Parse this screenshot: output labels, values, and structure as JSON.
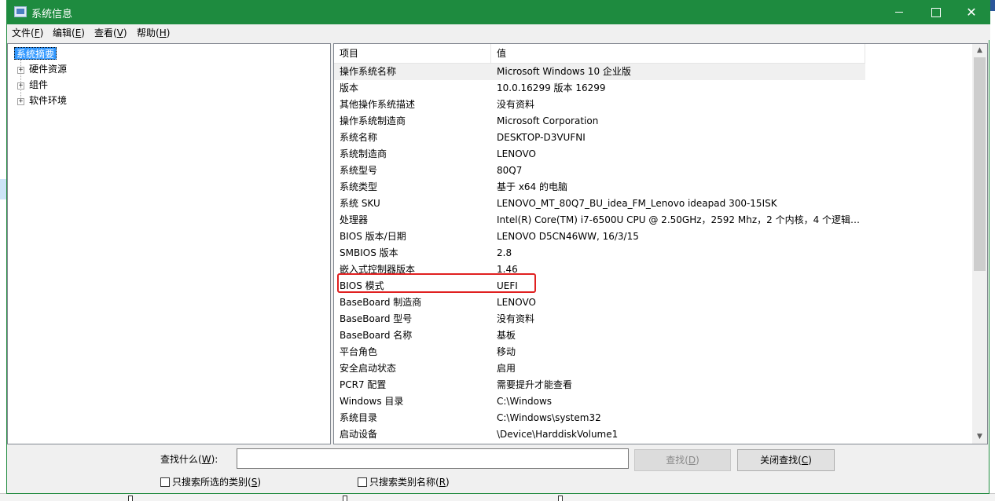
{
  "window": {
    "title": "系统信息",
    "minimize_glyph": "",
    "maximize_glyph": "",
    "close_glyph": "✕"
  },
  "menu": [
    {
      "label": "文件(",
      "key": "F",
      "tail": ")"
    },
    {
      "label": "编辑(",
      "key": "E",
      "tail": ")"
    },
    {
      "label": "查看(",
      "key": "V",
      "tail": ")"
    },
    {
      "label": "帮助(",
      "key": "H",
      "tail": ")"
    }
  ],
  "tree": {
    "root": "系统摘要",
    "expander": "+",
    "nodes": [
      "硬件资源",
      "组件",
      "软件环境"
    ]
  },
  "list": {
    "columns": [
      "项目",
      "值"
    ],
    "rows": [
      {
        "item": "操作系统名称",
        "value": "Microsoft Windows 10 企业版"
      },
      {
        "item": "版本",
        "value": "10.0.16299 版本 16299"
      },
      {
        "item": "其他操作系统描述",
        "value": "没有资料"
      },
      {
        "item": "操作系统制造商",
        "value": "Microsoft Corporation"
      },
      {
        "item": "系统名称",
        "value": "DESKTOP-D3VUFNI"
      },
      {
        "item": "系统制造商",
        "value": "LENOVO"
      },
      {
        "item": "系统型号",
        "value": "80Q7"
      },
      {
        "item": "系统类型",
        "value": "基于 x64 的电脑"
      },
      {
        "item": "系统 SKU",
        "value": "LENOVO_MT_80Q7_BU_idea_FM_Lenovo ideapad 300-15ISK"
      },
      {
        "item": "处理器",
        "value": "Intel(R) Core(TM) i7-6500U CPU @ 2.50GHz，2592 Mhz，2 个内核，4 个逻辑处..."
      },
      {
        "item": "BIOS 版本/日期",
        "value": "LENOVO D5CN46WW, 16/3/15"
      },
      {
        "item": "SMBIOS 版本",
        "value": "2.8"
      },
      {
        "item": "嵌入式控制器版本",
        "value": "1.46"
      },
      {
        "item": "BIOS 模式",
        "value": "UEFI"
      },
      {
        "item": "BaseBoard 制造商",
        "value": "LENOVO"
      },
      {
        "item": "BaseBoard 型号",
        "value": "没有资料"
      },
      {
        "item": "BaseBoard 名称",
        "value": "基板"
      },
      {
        "item": "平台角色",
        "value": "移动"
      },
      {
        "item": "安全启动状态",
        "value": "启用"
      },
      {
        "item": "PCR7 配置",
        "value": "需要提升才能查看"
      },
      {
        "item": "Windows 目录",
        "value": "C:\\Windows"
      },
      {
        "item": "系统目录",
        "value": "C:\\Windows\\system32"
      },
      {
        "item": "启动设备",
        "value": "\\Device\\HarddiskVolume1"
      }
    ],
    "scroll_up": "▲",
    "scroll_down": "▼"
  },
  "find": {
    "label": "查找什么(",
    "label_key": "W",
    "label_tail": "):",
    "input_value": "",
    "find_button": {
      "label": "查找(",
      "key": "D",
      "tail": ")"
    },
    "close_button": {
      "label": "关闭查找(",
      "key": "C",
      "tail": ")"
    },
    "checkbox_selected": {
      "label": "只搜索所选的类别(",
      "key": "S",
      "tail": ")",
      "checked": false
    },
    "checkbox_names": {
      "label": "只搜索类别名称(",
      "key": "R",
      "tail": ")",
      "checked": false
    }
  },
  "colors": {
    "titlebar": "#1e8b3f",
    "selection": "#3399ff",
    "highlight_box": "#e02020"
  }
}
